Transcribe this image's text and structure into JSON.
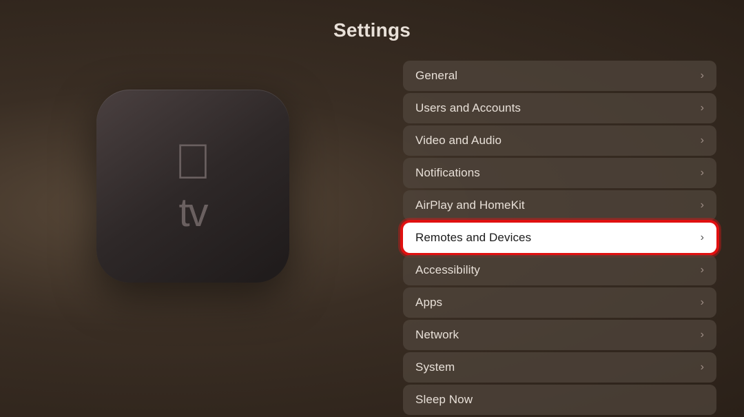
{
  "page": {
    "title": "Settings"
  },
  "appletv": {
    "tv_label": "tv"
  },
  "settings": {
    "items": [
      {
        "id": "general",
        "label": "General",
        "highlighted": false
      },
      {
        "id": "users-accounts",
        "label": "Users and Accounts",
        "highlighted": false
      },
      {
        "id": "video-audio",
        "label": "Video and Audio",
        "highlighted": false
      },
      {
        "id": "notifications",
        "label": "Notifications",
        "highlighted": false
      },
      {
        "id": "airplay-homekit",
        "label": "AirPlay and HomeKit",
        "highlighted": false
      },
      {
        "id": "remotes-devices",
        "label": "Remotes and Devices",
        "highlighted": true
      },
      {
        "id": "accessibility",
        "label": "Accessibility",
        "highlighted": false
      },
      {
        "id": "apps",
        "label": "Apps",
        "highlighted": false
      },
      {
        "id": "network",
        "label": "Network",
        "highlighted": false
      },
      {
        "id": "system",
        "label": "System",
        "highlighted": false
      },
      {
        "id": "sleep-now",
        "label": "Sleep Now",
        "highlighted": false
      }
    ],
    "chevron": "›"
  }
}
